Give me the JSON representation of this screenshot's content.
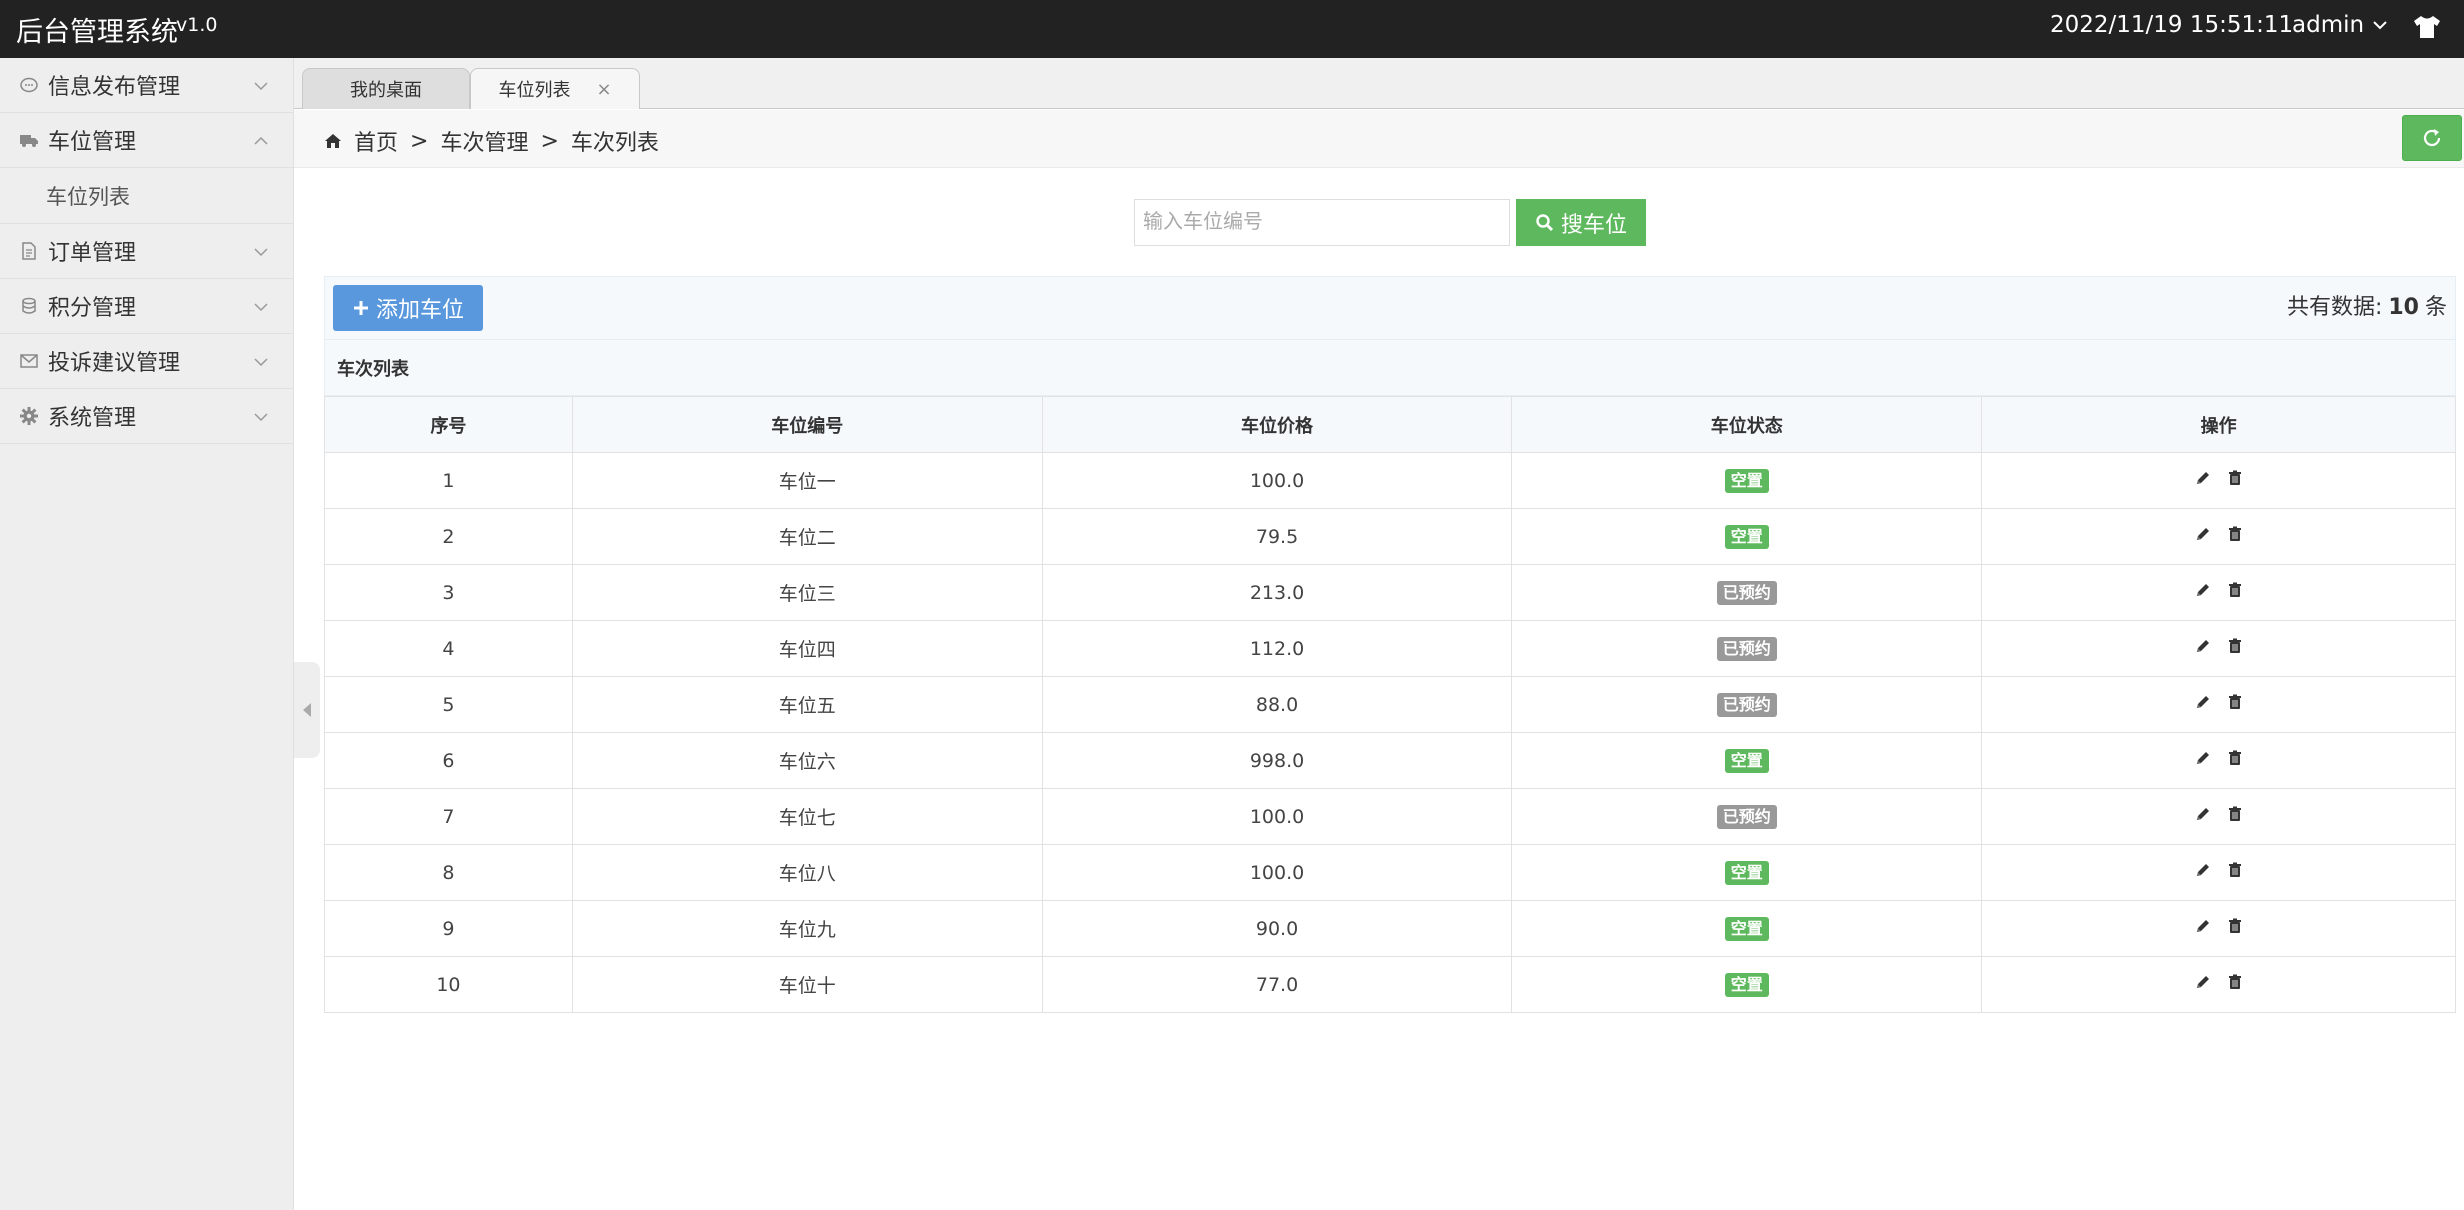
{
  "header": {
    "title": "后台管理系统",
    "version": "v1.0",
    "datetime": "2022/11/19 15:51:11",
    "user": "admin"
  },
  "sidebar": {
    "items": [
      {
        "label": "信息发布管理",
        "icon": "chat-icon",
        "expanded": false
      },
      {
        "label": "车位管理",
        "icon": "truck-icon",
        "expanded": true,
        "children": [
          "车位列表"
        ]
      },
      {
        "label": "订单管理",
        "icon": "document-icon",
        "expanded": false
      },
      {
        "label": "积分管理",
        "icon": "database-icon",
        "expanded": false
      },
      {
        "label": "投诉建议管理",
        "icon": "envelope-icon",
        "expanded": false
      },
      {
        "label": "系统管理",
        "icon": "gear-icon",
        "expanded": false
      }
    ]
  },
  "tabs": [
    {
      "label": "我的桌面",
      "active": false
    },
    {
      "label": "车位列表",
      "active": true,
      "close": "×"
    }
  ],
  "breadcrumb": {
    "home": "首页",
    "sep": ">",
    "level1": "车次管理",
    "level2": "车次列表"
  },
  "search": {
    "placeholder": "输入车位编号",
    "value": "",
    "button": "搜车位"
  },
  "toolbar": {
    "add_label": "添加车位",
    "total_prefix": "共有数据:",
    "total_count": "10",
    "total_suffix": "条"
  },
  "list_title": "车次列表",
  "table": {
    "columns": [
      "序号",
      "车位编号",
      "车位价格",
      "车位状态",
      "操作"
    ],
    "rows": [
      {
        "index": "1",
        "code": "车位一",
        "price": "100.0",
        "status": "空置"
      },
      {
        "index": "2",
        "code": "车位二",
        "price": "79.5",
        "status": "空置"
      },
      {
        "index": "3",
        "code": "车位三",
        "price": "213.0",
        "status": "已预约"
      },
      {
        "index": "4",
        "code": "车位四",
        "price": "112.0",
        "status": "已预约"
      },
      {
        "index": "5",
        "code": "车位五",
        "price": "88.0",
        "status": "已预约"
      },
      {
        "index": "6",
        "code": "车位六",
        "price": "998.0",
        "status": "空置"
      },
      {
        "index": "7",
        "code": "车位七",
        "price": "100.0",
        "status": "已预约"
      },
      {
        "index": "8",
        "code": "车位八",
        "price": "100.0",
        "status": "空置"
      },
      {
        "index": "9",
        "code": "车位九",
        "price": "90.0",
        "status": "空置"
      },
      {
        "index": "10",
        "code": "车位十",
        "price": "77.0",
        "status": "空置"
      }
    ]
  },
  "colors": {
    "topbar": "#222222",
    "sidebar": "#eeeeee",
    "green": "#5eb95e",
    "blue": "#5a98de",
    "badge_vacant": "#5eb95e",
    "badge_reserved": "#999999"
  }
}
